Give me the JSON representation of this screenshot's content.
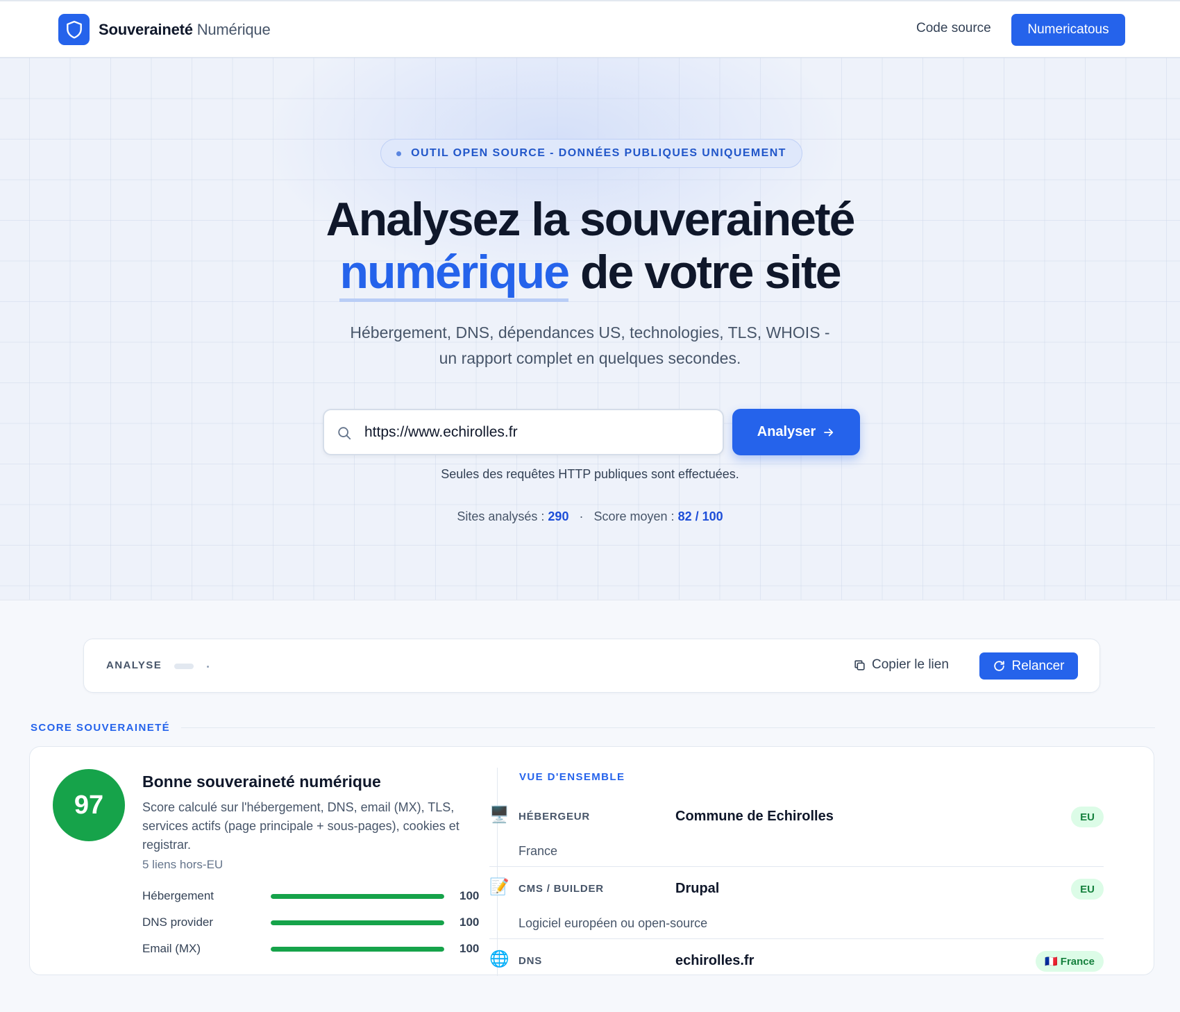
{
  "header": {
    "brand_strong": "Souveraineté",
    "brand_light": "Numérique",
    "nav_link": "Code source",
    "nav_button": "Numericatous"
  },
  "hero": {
    "pill": "OUTIL OPEN SOURCE - DONNÉES PUBLIQUES UNIQUEMENT",
    "title_line1": "Analysez la souveraineté",
    "title_accent": "numérique",
    "title_rest": "de votre site",
    "subtitle_line1": "Hébergement, DNS, dépendances US, technologies, TLS, WHOIS -",
    "subtitle_line2": "un rapport complet en quelques secondes.",
    "search_value": "https://www.echirolles.fr",
    "analyse_button": "Analyser",
    "note": "Seules des requêtes HTTP publiques sont effectuées.",
    "stats": {
      "sites_label": "Sites analysés :",
      "sites_value": "290",
      "separator": "·",
      "score_label": "Score moyen :",
      "score_value": "82 / 100"
    }
  },
  "analyse_bar": {
    "label": "ANALYSE",
    "copy_link": "Copier le lien",
    "relancer": "Relancer"
  },
  "score_section": {
    "label": "SCORE SOUVERAINETÉ",
    "score": "97",
    "title": "Bonne souveraineté numérique",
    "description": "Score calculé sur l'hébergement, DNS, email (MX), TLS, services actifs (page principale + sous-pages), cookies et registrar.",
    "hors_eu": "5 liens hors-EU",
    "bars": [
      {
        "label": "Hébergement",
        "value": "100",
        "fraction": 1.0
      },
      {
        "label": "DNS provider",
        "value": "100",
        "fraction": 1.0
      },
      {
        "label": "Email (MX)",
        "value": "100",
        "fraction": 1.0
      }
    ],
    "score_color": "#16a34a"
  },
  "overview": {
    "label": "VUE D'ENSEMBLE",
    "rows": [
      {
        "icon": "🖥️",
        "icon_name": "desktop-computer-icon",
        "key": "HÉBERGEUR",
        "value": "Commune de Echirolles",
        "sub": "France",
        "badge": "EU"
      },
      {
        "icon": "📝",
        "icon_name": "memo-icon",
        "key": "CMS / BUILDER",
        "value": "Drupal",
        "sub": "Logiciel européen ou open-source",
        "badge": "EU"
      },
      {
        "icon": "🌐",
        "icon_name": "globe-icon",
        "key": "DNS",
        "value": "echirolles.fr",
        "sub": "",
        "badge": "🇫🇷 France"
      }
    ]
  },
  "colors": {
    "accent": "#2563eb",
    "success": "#16a34a",
    "badge_bg": "#dcfce7"
  }
}
